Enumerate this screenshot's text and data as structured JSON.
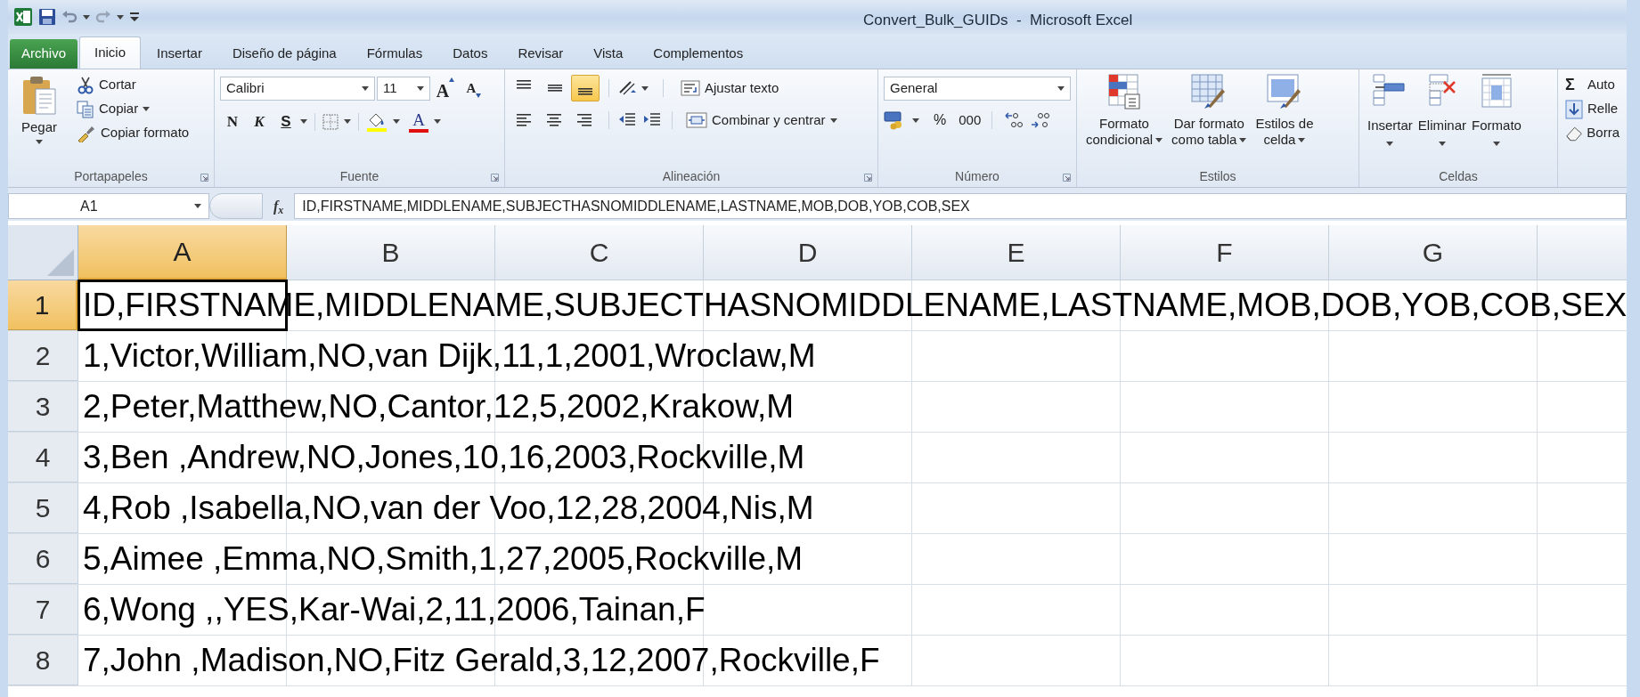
{
  "window": {
    "title": "Convert_Bulk_GUIDs  -  Microsoft Excel"
  },
  "tabs": [
    {
      "label": "Archivo",
      "kind": "file",
      "selected": false
    },
    {
      "label": "Inicio",
      "kind": "tab",
      "selected": true
    },
    {
      "label": "Insertar",
      "kind": "tab",
      "selected": false
    },
    {
      "label": "Diseño de página",
      "kind": "tab",
      "selected": false
    },
    {
      "label": "Fórmulas",
      "kind": "tab",
      "selected": false
    },
    {
      "label": "Datos",
      "kind": "tab",
      "selected": false
    },
    {
      "label": "Revisar",
      "kind": "tab",
      "selected": false
    },
    {
      "label": "Vista",
      "kind": "tab",
      "selected": false
    },
    {
      "label": "Complementos",
      "kind": "tab",
      "selected": false
    }
  ],
  "clipboard": {
    "title": "Portapapeles",
    "paste": "Pegar",
    "cut": "Cortar",
    "copy": "Copiar",
    "format_painter": "Copiar formato"
  },
  "font": {
    "title": "Fuente",
    "family": "Calibri",
    "size": "11",
    "grow": "A",
    "shrink": "A",
    "bold": "N",
    "italic": "K",
    "underline": "S",
    "font_color": "A"
  },
  "alignment": {
    "title": "Alineación",
    "vertical": [
      {
        "kind": "top",
        "selected": false
      },
      {
        "kind": "middle",
        "selected": false
      },
      {
        "kind": "bottom",
        "selected": true
      }
    ],
    "wrap": "Ajustar texto",
    "merge": "Combinar y centrar"
  },
  "number": {
    "title": "Número",
    "format": "General",
    "percent": "%",
    "thousands": "000"
  },
  "styles": {
    "title": "Estilos",
    "buttons": [
      {
        "kind": "conditional",
        "lines": [
          "Formato",
          "condicional"
        ]
      },
      {
        "kind": "table",
        "lines": [
          "Dar formato",
          "como tabla"
        ]
      },
      {
        "kind": "cell",
        "lines": [
          "Estilos de",
          "celda"
        ]
      }
    ]
  },
  "cells": {
    "title": "Celdas",
    "buttons": [
      {
        "kind": "insert",
        "label": "Insertar"
      },
      {
        "kind": "delete",
        "label": "Eliminar"
      },
      {
        "kind": "format",
        "label": "Formato"
      }
    ]
  },
  "editing": {
    "sum_symbol": "Σ",
    "items": [
      {
        "kind": "sum",
        "label": "Auto"
      },
      {
        "kind": "fill",
        "label": "Relle"
      },
      {
        "kind": "clear",
        "label": "Borra"
      }
    ]
  },
  "formula_bar": {
    "name_box": "A1",
    "function_label": "f$_{x}$",
    "formula": "ID,FIRSTNAME,MIDDLENAME,SUBJECTHASNOMIDDLENAME,LASTNAME,MOB,DOB,YOB,COB,SEX"
  },
  "sheet": {
    "columns": [
      {
        "label": "A",
        "selected": true
      },
      {
        "label": "B",
        "selected": false
      },
      {
        "label": "C",
        "selected": false
      },
      {
        "label": "D",
        "selected": false
      },
      {
        "label": "E",
        "selected": false
      },
      {
        "label": "F",
        "selected": false
      },
      {
        "label": "G",
        "selected": false
      }
    ],
    "rows": [
      {
        "number": "1",
        "selected": true,
        "text": "ID,FIRSTNAME,MIDDLENAME,SUBJECTHASNOMIDDLENAME,LASTNAME,MOB,DOB,YOB,COB,SEX"
      },
      {
        "number": "2",
        "selected": false,
        "text": "1,Victor,William,NO,van Dijk,11,1,2001,Wroclaw,M"
      },
      {
        "number": "3",
        "selected": false,
        "text": "2,Peter,Matthew,NO,Cantor,12,5,2002,Krakow,M"
      },
      {
        "number": "4",
        "selected": false,
        "text": "3,Ben ,Andrew,NO,Jones,10,16,2003,Rockville,M"
      },
      {
        "number": "5",
        "selected": false,
        "text": "4,Rob ,Isabella,NO,van der Voo,12,28,2004,Nis,M"
      },
      {
        "number": "6",
        "selected": false,
        "text": "5,Aimee ,Emma,NO,Smith,1,27,2005,Rockville,M"
      },
      {
        "number": "7",
        "selected": false,
        "text": "6,Wong ,,YES,Kar-Wai,2,11,2006,Tainan,F"
      },
      {
        "number": "8",
        "selected": false,
        "text": "7,John ,Madison,NO,Fitz Gerald,3,12,2007,Rockville,F"
      }
    ]
  }
}
